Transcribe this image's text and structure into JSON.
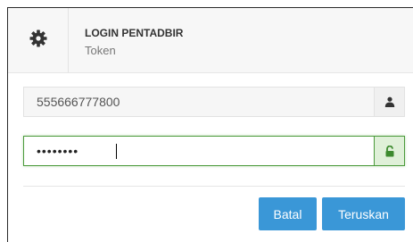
{
  "header": {
    "title": "LOGIN PENTADBIR",
    "subtitle": "Token",
    "icon": "gear-icon"
  },
  "form": {
    "username_value": "555666777800",
    "username_icon": "user-icon",
    "password_value": "********",
    "password_icon": "unlock-icon"
  },
  "buttons": {
    "cancel_label": "Batal",
    "next_label": "Teruskan"
  },
  "colors": {
    "primary": "#3a97d7",
    "success_border": "#4a9a3a",
    "success_addon_bg": "#dff0d8"
  }
}
